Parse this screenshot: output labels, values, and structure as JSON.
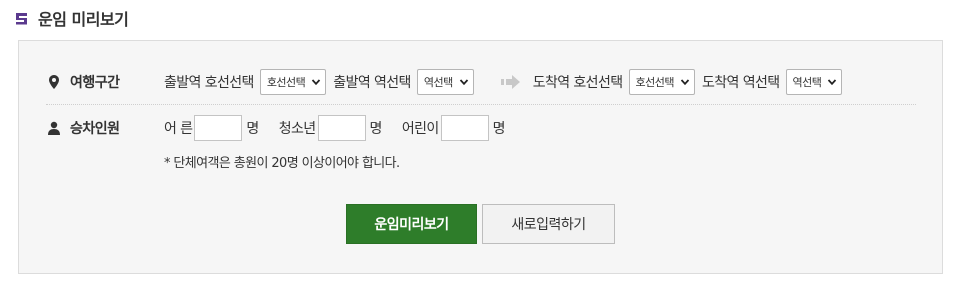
{
  "section": {
    "title": "운임 미리보기"
  },
  "route": {
    "label": "여행구간",
    "departure_line_label": "출발역 호선선택",
    "departure_line_select": "호선선택",
    "departure_station_label": "출발역 역선택",
    "departure_station_select": "역선택",
    "arrival_line_label": "도착역 호선선택",
    "arrival_line_select": "호선선택",
    "arrival_station_label": "도착역 역선택",
    "arrival_station_select": "역선택"
  },
  "passengers": {
    "label": "승차인원",
    "adult_label": "어 른",
    "youth_label": "청소년",
    "child_label": "어린이",
    "unit": "명",
    "adult_value": "",
    "youth_value": "",
    "child_value": "",
    "note": "* 단체여객은 총원이 20명 이상이어야 합니다."
  },
  "buttons": {
    "preview": "운임미리보기",
    "reset": "새로입력하기"
  },
  "colors": {
    "primary_button": "#2e7d2a",
    "title_icon": "#5b3a8e"
  }
}
